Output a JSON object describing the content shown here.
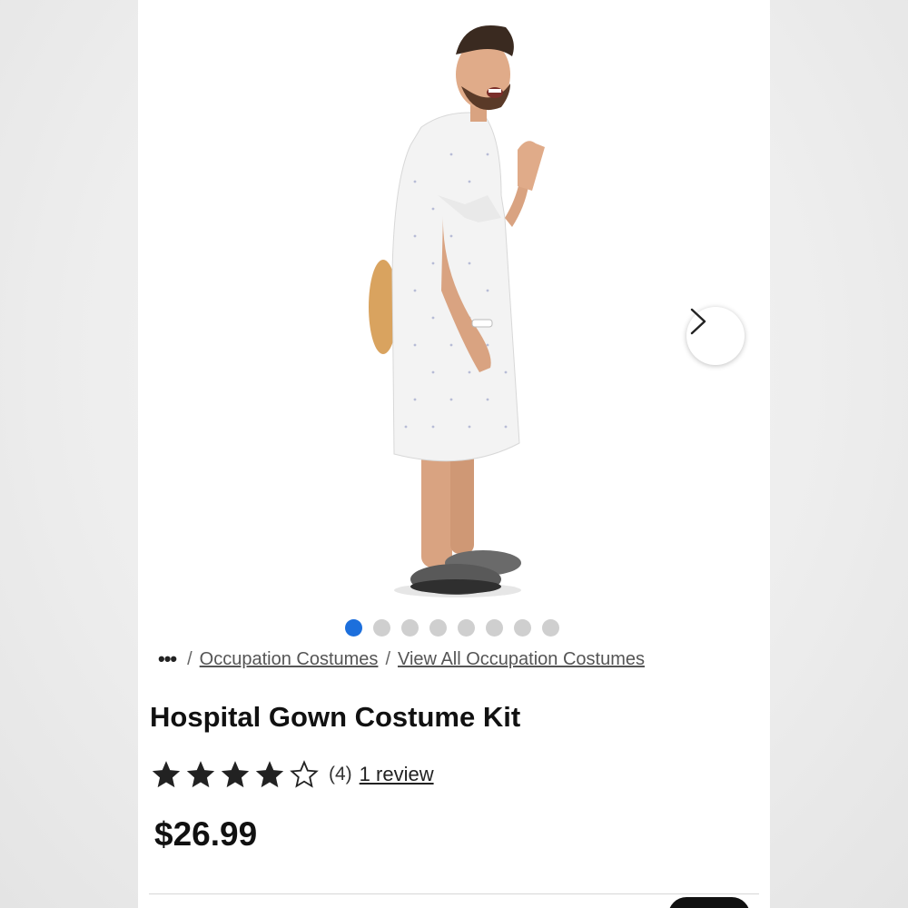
{
  "product": {
    "title": "Hospital Gown Costume Kit",
    "rating": 4,
    "rating_max": 5,
    "rating_count": "(4)",
    "review_link": "1 review",
    "price": "$26.99"
  },
  "breadcrumb": {
    "more": "•••",
    "separator": "/",
    "items": [
      "Occupation Costumes",
      "View All Occupation Costumes"
    ]
  },
  "carousel": {
    "image_count": 8,
    "active_index": 0,
    "next_icon": "chevron-right-icon",
    "active_color": "#1c6fdc",
    "inactive_color": "#cfcfcf"
  }
}
